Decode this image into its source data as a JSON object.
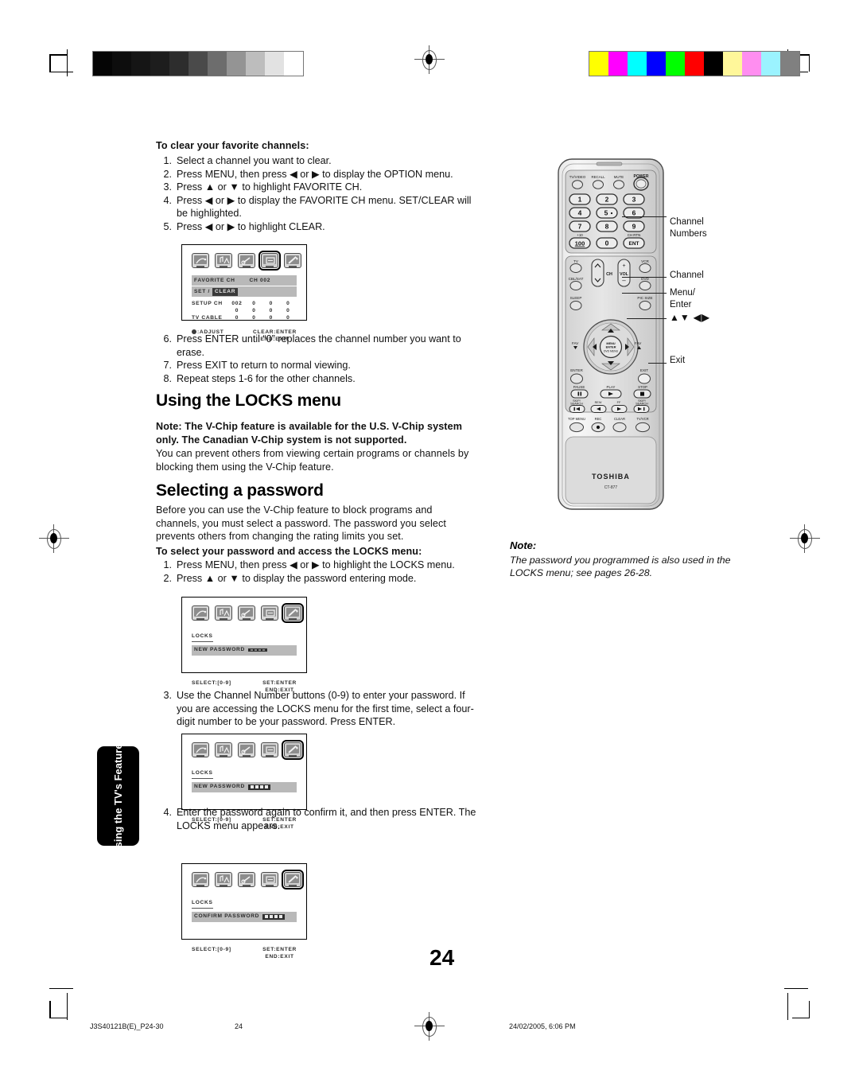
{
  "page": {
    "number": "24",
    "side_tab": "Using the TV's Features",
    "footer_left": "J3S40121B(E)_P24-30",
    "footer_page": "24",
    "footer_right": "24/02/2005, 6:06 PM"
  },
  "sections": {
    "clear_favorites": {
      "heading": "To clear your favorite channels:",
      "steps": [
        {
          "n": "1.",
          "t": "Select a channel you want to clear."
        },
        {
          "n": "2.",
          "t": "Press MENU, then press ◀ or ▶ to display the OPTION menu."
        },
        {
          "n": "3.",
          "t": "Press ▲ or ▼ to highlight FAVORITE CH."
        },
        {
          "n": "4.",
          "t": "Press ◀ or ▶ to display the FAVORITE CH menu. SET/CLEAR will be highlighted."
        },
        {
          "n": "5.",
          "t": "Press ◀ or ▶ to highlight CLEAR."
        }
      ],
      "steps_after": [
        {
          "n": "6.",
          "t": "Press ENTER until “0” replaces the channel number you want to erase."
        },
        {
          "n": "7.",
          "t": "Press EXIT to return to normal viewing."
        },
        {
          "n": "8.",
          "t": "Repeat steps 1-6 for the other channels."
        }
      ]
    },
    "locks_menu": {
      "heading": "Using the LOCKS menu",
      "note_bold": "Note: The V-Chip feature is available for the U.S. V-Chip system only. The Canadian V-Chip system is not supported.",
      "body": "You can prevent others from viewing certain programs or channels by blocking them using the V-Chip feature."
    },
    "selecting_password": {
      "heading": "Selecting a password",
      "body": "Before you can use the V-Chip feature to block programs and channels, you must select a password. The password you select prevents others from changing the rating limits you set.",
      "sub_heading": "To select your password and access the LOCKS menu:",
      "steps": [
        {
          "n": "1.",
          "t": "Press MENU, then press ◀ or ▶ to highlight the LOCKS menu."
        },
        {
          "n": "2.",
          "t": "Press ▲ or ▼ to display the password entering mode."
        }
      ],
      "step3": {
        "n": "3.",
        "t": "Use the Channel Number buttons (0-9) to enter your password. If you are accessing the LOCKS menu for the first time, select a four-digit number to be your password. Press ENTER."
      },
      "step4": {
        "n": "4.",
        "t": "Enter the password again to confirm it, and then press ENTER. The LOCKS menu appears."
      }
    },
    "note_box": {
      "title": "Note:",
      "body": "The password you programmed is also used in the LOCKS menu; see pages 26-28."
    }
  },
  "osd_favorite": {
    "selected_icon_index": 3,
    "title_left": "FAVORITE CH",
    "title_right": "CH 002",
    "row_set": "SET /",
    "row_set_highlight": "CLEAR",
    "grid": [
      {
        "label": "SETUP CH",
        "cells": [
          "002",
          "0",
          "0",
          "0"
        ]
      },
      {
        "label": "",
        "cells": [
          "0",
          "0",
          "0",
          "0"
        ]
      },
      {
        "label": "TV CABLE",
        "cells": [
          "0",
          "0",
          "0",
          "0"
        ]
      }
    ],
    "foot_left": ":ADJUST",
    "foot_right_1": "CLEAR:ENTER",
    "foot_right_2": "END:EXIT"
  },
  "osd_new_password_empty": {
    "selected_icon_index": 4,
    "title": "LOCKS",
    "field_label": "NEW PASSWORD",
    "field_digits": 0,
    "foot_left": "SELECT:[0-9]",
    "foot_right_1": "SET:ENTER",
    "foot_right_2": "END:EXIT"
  },
  "osd_new_password_filled": {
    "selected_icon_index": 4,
    "title": "LOCKS",
    "field_label": "NEW PASSWORD",
    "field_digits": 4,
    "foot_left": "SELECT:[0-9]",
    "foot_right_1": "SET:ENTER",
    "foot_right_2": "END:EXIT"
  },
  "osd_confirm_password": {
    "selected_icon_index": 4,
    "title": "LOCKS",
    "field_label": "CONFIRM PASSWORD",
    "field_digits": 4,
    "foot_left": "SELECT:[0-9]",
    "foot_right_1": "SET:ENTER",
    "foot_right_2": "END:EXIT"
  },
  "remote": {
    "brand": "TOSHIBA",
    "model": "CT-877",
    "top_row": [
      "TV/VIDEO",
      "RECALL",
      "MUTE",
      "POWER"
    ],
    "keypad": [
      [
        "1",
        "2",
        "3"
      ],
      [
        "4",
        "5",
        "6"
      ],
      [
        "7",
        "8",
        "9"
      ],
      [
        "100",
        "0",
        "ENT"
      ]
    ],
    "keypad_sup_left": "+10",
    "keypad_sup_right": "CH RTN",
    "mode_row_1": [
      "TV",
      "VCR"
    ],
    "mode_row_2": [
      "CBL/SAT",
      "DVD"
    ],
    "mode_row_3": [
      "SLEEP",
      "PIC SIZE"
    ],
    "ch_label": "CH",
    "vol_label": "VOL",
    "fav_down": "FAV",
    "fav_up": "FAV",
    "center_lines": [
      "MENU",
      "ENTER",
      "DVD MENU"
    ],
    "enter_label": "ENTER",
    "exit_label": "EXIT",
    "transport": [
      "PAUSE",
      "PLAY",
      "STOP"
    ],
    "transport2": [
      "SKIP/SEARCH",
      "REW",
      "FF",
      "SKIP/SEARCH"
    ],
    "bottom_row": [
      "TOP MENU",
      "REC",
      "CLEAR",
      "TV/VCR"
    ],
    "callouts": [
      {
        "id": "channel-numbers",
        "lines": [
          "Channel",
          "Numbers"
        ]
      },
      {
        "id": "channel",
        "lines": [
          "Channel"
        ]
      },
      {
        "id": "menu-enter",
        "lines": [
          "Menu/",
          "Enter"
        ]
      },
      {
        "id": "arrows",
        "lines": [
          "▲▼ ◀▶"
        ]
      },
      {
        "id": "exit",
        "lines": [
          "Exit"
        ]
      }
    ]
  },
  "press_marks": {
    "gray_swatches": [
      "#050505",
      "#0d0d0d",
      "#151515",
      "#1d1d1d",
      "#2d2d2d",
      "#4a4a4a",
      "#6d6d6d",
      "#949494",
      "#bdbdbd",
      "#e2e2e2",
      "#ffffff"
    ],
    "color_swatches": [
      "#ffff00",
      "#ff00ff",
      "#00ffff",
      "#0000ff",
      "#00ff00",
      "#ff0000",
      "#000000",
      "#fff79a",
      "#ff8ef0",
      "#9bf3ff",
      "#808080"
    ]
  }
}
